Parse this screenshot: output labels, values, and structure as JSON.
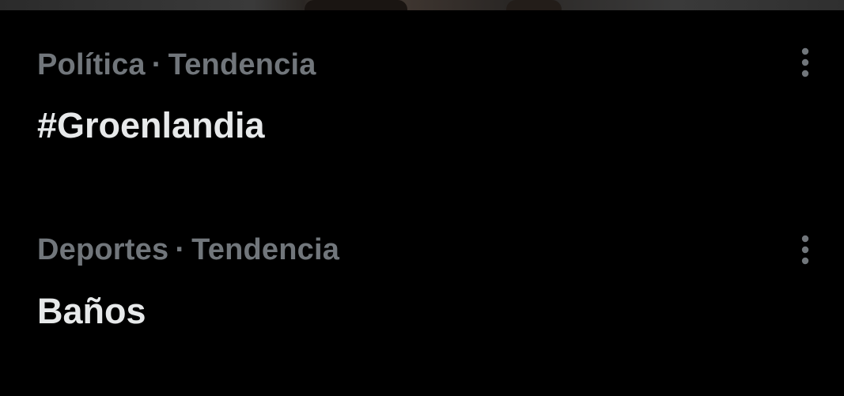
{
  "header_image": {
    "icon": "photo-banner"
  },
  "trends": [
    {
      "category": "Política",
      "separator": "·",
      "status": "Tendencia",
      "title": "#Groenlandia",
      "more_icon": "more-vertical-icon"
    },
    {
      "category": "Deportes",
      "separator": "·",
      "status": "Tendencia",
      "title": "Baños",
      "more_icon": "more-vertical-icon"
    }
  ],
  "colors": {
    "background": "#000000",
    "meta_text": "#71767b",
    "title_text": "#e7e9ea",
    "icon": "#71767b"
  }
}
